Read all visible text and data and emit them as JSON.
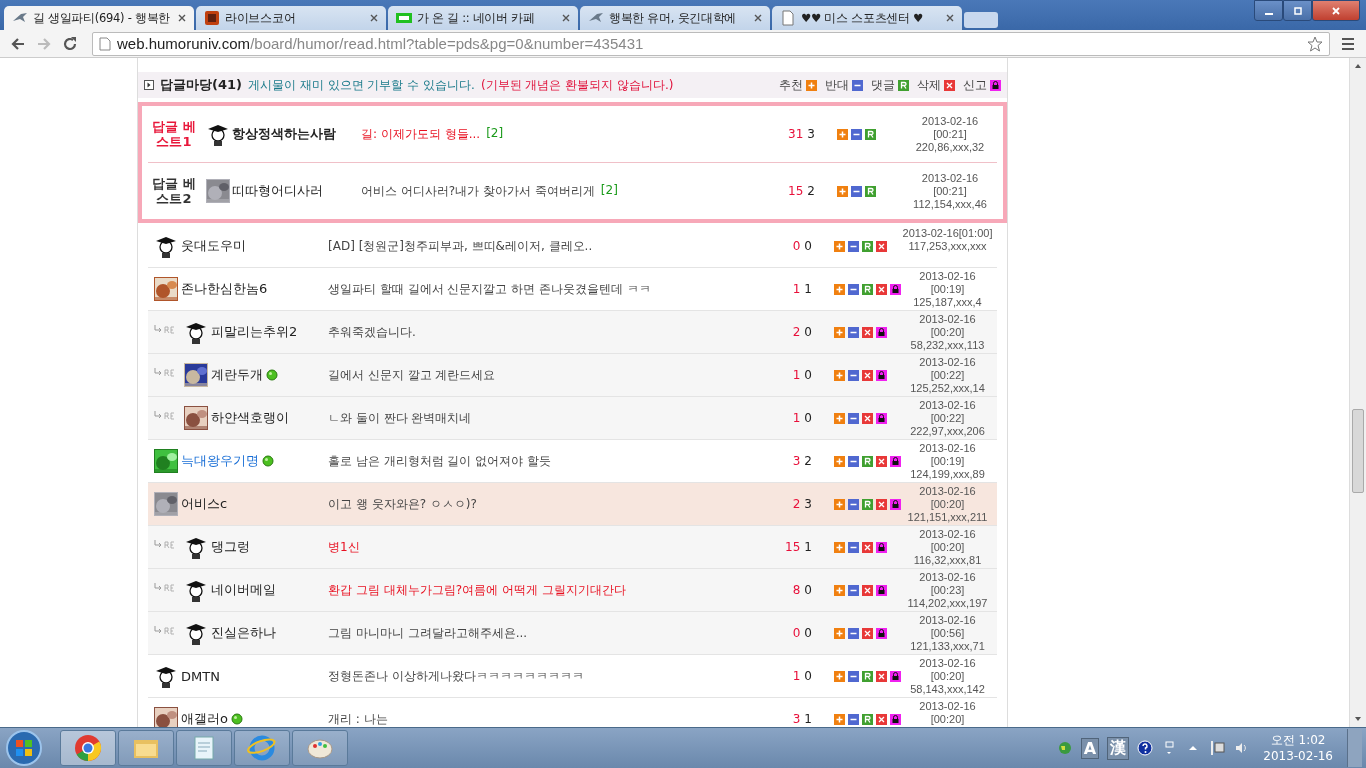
{
  "tabs": [
    {
      "title": "길 생일파티(694) - 행복한",
      "kind": "bird",
      "selected": true
    },
    {
      "title": "라이브스코어",
      "kind": "cube",
      "selected": false
    },
    {
      "title": "가 온 길 :: 네이버 카페",
      "kind": "cafe",
      "selected": false
    },
    {
      "title": "행복한 유머, 웃긴대학에",
      "kind": "bird",
      "selected": false
    },
    {
      "title": "♥♥ 미스 스포츠센터 ♥",
      "kind": "page",
      "selected": false
    }
  ],
  "toolbar": {
    "back_disabled": false,
    "forward_disabled": true,
    "url_domain": "web.humoruniv.com",
    "url_path": "/board/humor/read.html?table=pds&pg=0&number=435431"
  },
  "header": {
    "title": "답글마당(41)",
    "notice": "게시물이 재미 있으면 기부할 수 있습니다.",
    "warning": "(기부된 개념은 환불되지 않습니다.)",
    "legend": [
      {
        "label": "추천",
        "kind": "up"
      },
      {
        "label": "반대",
        "kind": "down"
      },
      {
        "label": "댓글",
        "kind": "reply"
      },
      {
        "label": "삭제",
        "kind": "delete"
      },
      {
        "label": "신고",
        "kind": "report"
      }
    ]
  },
  "best": [
    {
      "label": "답글 베스트1",
      "color": "#e8173a",
      "avatar": {
        "kind": "cap"
      },
      "nick": "항상정색하는사람",
      "bold": true,
      "title": "길: 이제가도되 형들...",
      "hot": true,
      "comments": "[2]",
      "up": "31",
      "down": "3",
      "date": "2013-02-16",
      "time": "[00:21]",
      "ip": "220,86,xxx,32"
    },
    {
      "label": "답글 베스트2",
      "color": "#333333",
      "nick": "띠따형어디사러",
      "bold": false,
      "title": "어비스 어디사러?내가 찾아가서 죽여버리게",
      "hot": false,
      "comments": "[2]",
      "up": "15",
      "down": "2",
      "date": "2013-02-16",
      "time": "[00:21]",
      "ip": "112,154,xxx,46"
    }
  ],
  "rows": [
    {
      "reply": false,
      "avatar": {
        "kind": "cap"
      },
      "nick": "웃대도우미",
      "link": false,
      "online": false,
      "title": "[AD] [청원군]청주피부과, 쁘띠&레이저, 클레오..",
      "hot": false,
      "up": "0",
      "down": "0",
      "reply_btn": true,
      "delete_btn": true,
      "report_btn": false,
      "highlighted": false,
      "date": "2013-02-16[01:00]",
      "ip": "117,253,xxx,xxx"
    },
    {
      "reply": false,
      "nick": "존나한심한놈6",
      "link": false,
      "online": false,
      "title": "생일파티 할때 길에서 신문지깔고 하면 존나웃겼을텐데 ㅋㅋ",
      "hot": false,
      "up": "1",
      "down": "1",
      "reply_btn": true,
      "delete_btn": true,
      "report_btn": true,
      "highlighted": false,
      "date": "2013-02-16",
      "time": "[00:19]",
      "ip": "125,187,xxx,4"
    },
    {
      "reply": true,
      "avatar": {
        "kind": "cap"
      },
      "nick": "피말리는추위2",
      "link": false,
      "online": false,
      "title": "추워죽겠습니다.",
      "hot": false,
      "up": "2",
      "down": "0",
      "reply_btn": false,
      "delete_btn": true,
      "report_btn": true,
      "highlighted": false,
      "date": "2013-02-16",
      "time": "[00:20]",
      "ip": "58,232,xxx,113"
    },
    {
      "reply": true,
      "nick": "계란두개",
      "link": false,
      "online": true,
      "title": "길에서 신문지 깔고 계란드세요",
      "hot": false,
      "up": "1",
      "down": "0",
      "reply_btn": false,
      "delete_btn": true,
      "report_btn": true,
      "highlighted": false,
      "date": "2013-02-16",
      "time": "[00:22]",
      "ip": "125,252,xxx,14"
    },
    {
      "reply": true,
      "nick": "하얀색호랭이",
      "link": false,
      "online": false,
      "title": "ㄴ와 둘이 짠다 완벽매치네",
      "hot": false,
      "up": "1",
      "down": "0",
      "reply_btn": false,
      "delete_btn": true,
      "report_btn": true,
      "highlighted": false,
      "date": "2013-02-16",
      "time": "[00:22]",
      "ip": "222,97,xxx,206"
    },
    {
      "reply": false,
      "nick": "늑대왕우기명",
      "link": true,
      "online": true,
      "title": "홀로 남은 개리형처럼 길이 없어져야 할듯",
      "hot": false,
      "up": "3",
      "down": "2",
      "reply_btn": true,
      "delete_btn": true,
      "report_btn": true,
      "highlighted": false,
      "date": "2013-02-16",
      "time": "[00:19]",
      "ip": "124,199,xxx,89"
    },
    {
      "reply": false,
      "nick": "어비스c",
      "link": false,
      "online": false,
      "title": "이고 왱 웃자와욘? ㅇㅅㅇ)?",
      "hot": false,
      "up": "2",
      "down": "3",
      "reply_btn": true,
      "delete_btn": true,
      "report_btn": true,
      "highlighted": true,
      "date": "2013-02-16",
      "time": "[00:20]",
      "ip": "121,151,xxx,211"
    },
    {
      "reply": true,
      "avatar": {
        "kind": "cap"
      },
      "nick": "댕그렁",
      "link": false,
      "online": false,
      "title": "병1신",
      "hot": true,
      "up": "15",
      "down": "1",
      "reply_btn": false,
      "delete_btn": true,
      "report_btn": true,
      "highlighted": false,
      "date": "2013-02-16",
      "time": "[00:20]",
      "ip": "116,32,xxx,81"
    },
    {
      "reply": true,
      "avatar": {
        "kind": "cap"
      },
      "nick": "네이버메일",
      "link": false,
      "online": false,
      "title": "환갑 그림 대체누가그림?여름에 어떡게 그릴지기대간다",
      "hot": true,
      "up": "8",
      "down": "0",
      "reply_btn": false,
      "delete_btn": true,
      "report_btn": true,
      "highlighted": false,
      "date": "2013-02-16",
      "time": "[00:23]",
      "ip": "114,202,xxx,197"
    },
    {
      "reply": true,
      "avatar": {
        "kind": "cap"
      },
      "nick": "진실은하나",
      "link": false,
      "online": false,
      "title": "그림 마니마니 그려달라고해주세욘...",
      "hot": false,
      "up": "0",
      "down": "0",
      "reply_btn": false,
      "delete_btn": true,
      "report_btn": true,
      "highlighted": false,
      "date": "2013-02-16",
      "time": "[00:56]",
      "ip": "121,133,xxx,71"
    },
    {
      "reply": false,
      "avatar": {
        "kind": "cap"
      },
      "nick": "DMTN",
      "link": false,
      "online": false,
      "title": "정형돈존나 이상하게나왔다ㅋㅋㅋㅋㅋㅋㅋㅋㅋ",
      "hot": false,
      "up": "1",
      "down": "0",
      "reply_btn": true,
      "delete_btn": true,
      "report_btn": true,
      "highlighted": false,
      "date": "2013-02-16",
      "time": "[00:20]",
      "ip": "58,143,xxx,142"
    },
    {
      "reply": false,
      "nick": "애갤러o",
      "link": false,
      "online": true,
      "title": "개리 : 나는",
      "hot": false,
      "up": "3",
      "down": "1",
      "reply_btn": true,
      "delete_btn": true,
      "report_btn": true,
      "highlighted": false,
      "date": "2013-02-16",
      "time": "[00:20]"
    }
  ],
  "taskbar": {
    "apps": [
      {
        "kind": "chrome",
        "selected": true
      },
      {
        "kind": "folder",
        "selected": false
      },
      {
        "kind": "notepad",
        "selected": false
      },
      {
        "kind": "ie",
        "selected": false
      },
      {
        "kind": "paint",
        "selected": false
      }
    ],
    "ime": [
      "A",
      "漢"
    ],
    "clock_time": "오전 1:02",
    "clock_date": "2013-02-16"
  }
}
